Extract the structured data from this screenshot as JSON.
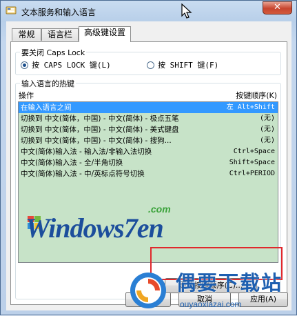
{
  "window": {
    "title": "文本服务和输入语言",
    "close_glyph": "✕"
  },
  "tabs": [
    {
      "label": "常规",
      "active": false
    },
    {
      "label": "语言栏",
      "active": false
    },
    {
      "label": "高级键设置",
      "active": true
    }
  ],
  "caps_lock": {
    "group_label": "要关闭 Caps Lock",
    "option_capslock": "按 CAPS LOCK 键(L)",
    "option_shift": "按 SHIFT 键(F)",
    "selected": "capslock"
  },
  "hotkeys": {
    "group_label": "输入语言的热键",
    "col_action": "操作",
    "col_key": "按键顺序(K)",
    "rows": [
      {
        "action": "在输入语言之间",
        "key": "左 Alt+Shift",
        "selected": true
      },
      {
        "action": "切换到 中文(简体，中国) - 中文(简体) - 极点五笔",
        "key": "(无)",
        "selected": false
      },
      {
        "action": "切换到 中文(简体，中国) - 中文(简体) - 美式键盘",
        "key": "(无)",
        "selected": false
      },
      {
        "action": "切换到 中文(简体，中国) - 中文(简体) - 搜狗...",
        "key": "(无)",
        "selected": false
      },
      {
        "action": "中文(简体)输入法 - 输入法/非输入法切换",
        "key": "Ctrl+Space",
        "selected": false
      },
      {
        "action": "中文(简体)输入法 - 全/半角切换",
        "key": "Shift+Space",
        "selected": false
      },
      {
        "action": "中文(简体)输入法 - 中/英标点符号切换",
        "key": "Ctrl+PERIOD",
        "selected": false
      }
    ],
    "change_button": "更改按键顺序(C)..."
  },
  "footer": {
    "ok": "确定",
    "cancel": "取消",
    "apply": "应用(A)"
  },
  "watermarks": {
    "windows7en": "Windows7en",
    "windows7en_com": ".com",
    "site_name": "偶要下载站",
    "site_url": "ouyaoxiazai.com"
  },
  "colors": {
    "selected_row": "#3399ff",
    "list_bg": "#c7e3c8",
    "highlight": "#e0282c"
  }
}
